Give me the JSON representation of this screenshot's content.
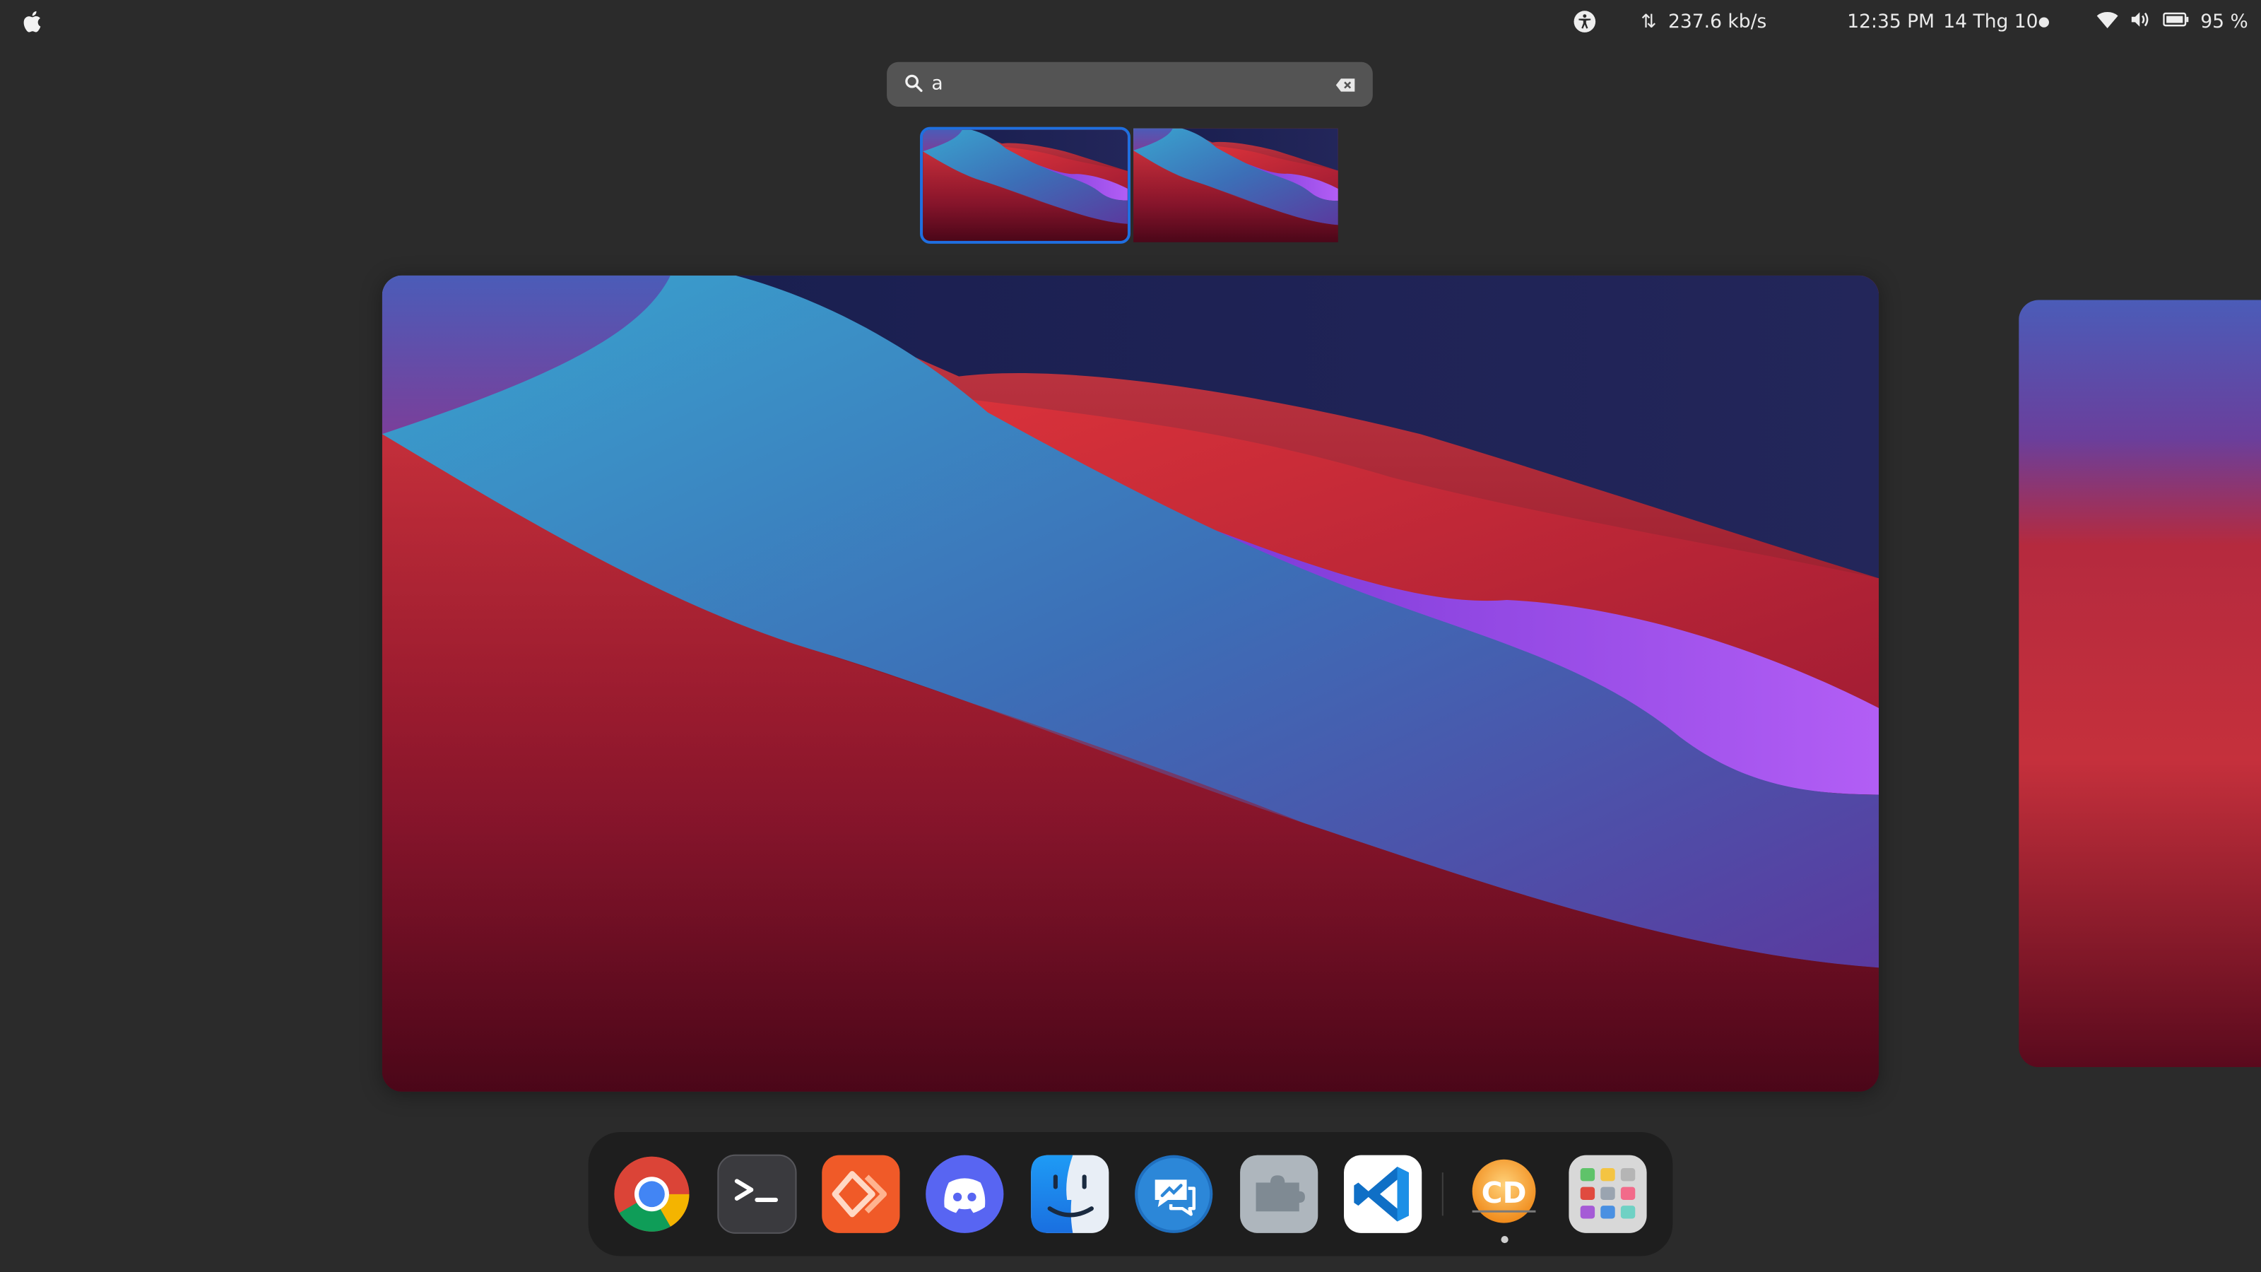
{
  "topbar": {
    "apple_icon": "apple-logo-icon",
    "accessibility_icon": "accessibility-icon",
    "network_icon": "network-transfer-icon",
    "network_speed": "237.6 kb/s",
    "time": "12:35 PM",
    "date": "14 Thg 10",
    "status_dot_icon": "notification-dot-icon",
    "wifi_icon": "wifi-icon",
    "volume_icon": "volume-icon",
    "battery_icon": "battery-icon",
    "battery_label": "95 %"
  },
  "search": {
    "value": "a",
    "icon": "search-icon",
    "clear_icon": "clear-input-icon"
  },
  "workspaces": {
    "count_visible": 2,
    "selected_index": 0
  },
  "dock": {
    "apps": [
      {
        "name": "Google Chrome",
        "icon": "chrome-icon"
      },
      {
        "name": "Terminal",
        "icon": "terminal-icon"
      },
      {
        "name": "Code Editor",
        "icon": "orange-diamond-app-icon"
      },
      {
        "name": "Discord",
        "icon": "discord-icon"
      },
      {
        "name": "Finder",
        "icon": "finder-icon"
      },
      {
        "name": "Messenger",
        "icon": "messenger-icon"
      },
      {
        "name": "Extensions",
        "icon": "extensions-icon"
      },
      {
        "name": "Visual Studio Code",
        "icon": "vscode-icon"
      },
      {
        "name": "CD Player",
        "icon": "cd-app-icon"
      },
      {
        "name": "App Launcher",
        "icon": "app-grid-icon"
      }
    ],
    "running_app_index": 8
  },
  "colors": {
    "background": "#2b2b2b",
    "search_bg": "#545454",
    "selection": "#1f6fe0",
    "dock_bg": "#1e1e1e"
  }
}
